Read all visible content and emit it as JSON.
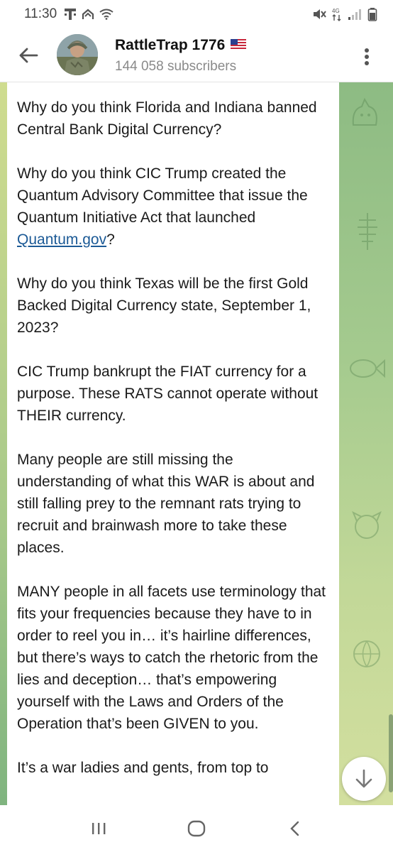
{
  "status_bar": {
    "time": "11:30",
    "left_icons": [
      "t-mobile-icon",
      "upload-icon",
      "wifi-icon"
    ],
    "right_icons": [
      "mute-icon",
      "data-icon",
      "signal-icon",
      "battery-icon"
    ]
  },
  "header": {
    "title": "RattleTrap 1776",
    "flag": "🇺🇸",
    "subscribers": "144 058 subscribers"
  },
  "message": {
    "p1": "Why do you think Florida and Indiana banned Central Bank Digital Currency?",
    "p2_before_link": "Why do you think CIC Trump created the Quantum Advisory Committee that issue the Quantum Initiative Act that launched ",
    "p2_link": "Quantum.gov",
    "p2_after_link": "?",
    "p3": "Why do you think Texas will be the first Gold Backed Digital Currency state, September 1, 2023?",
    "p4": "CIC Trump bankrupt the FIAT currency for a purpose. These RATS cannot operate without THEIR currency.",
    "p5": "Many people are still missing the understanding of what this WAR is about and still falling prey to the remnant rats trying to recruit and brainwash more to take these places.",
    "p6": "MANY people in all facets use terminology that fits your frequencies because they have to in order to reel you in… it’s hairline differences, but there’s ways to catch the rhetoric from the lies and deception… that’s empowering yourself with the Laws and Orders of the Operation that’s been GIVEN to you.",
    "p7": "It’s a war ladies and gents, from top to"
  },
  "colors": {
    "link": "#1c5a96",
    "chat_bg_top": "#c9d98e",
    "chat_bg_bottom": "#86b883"
  }
}
